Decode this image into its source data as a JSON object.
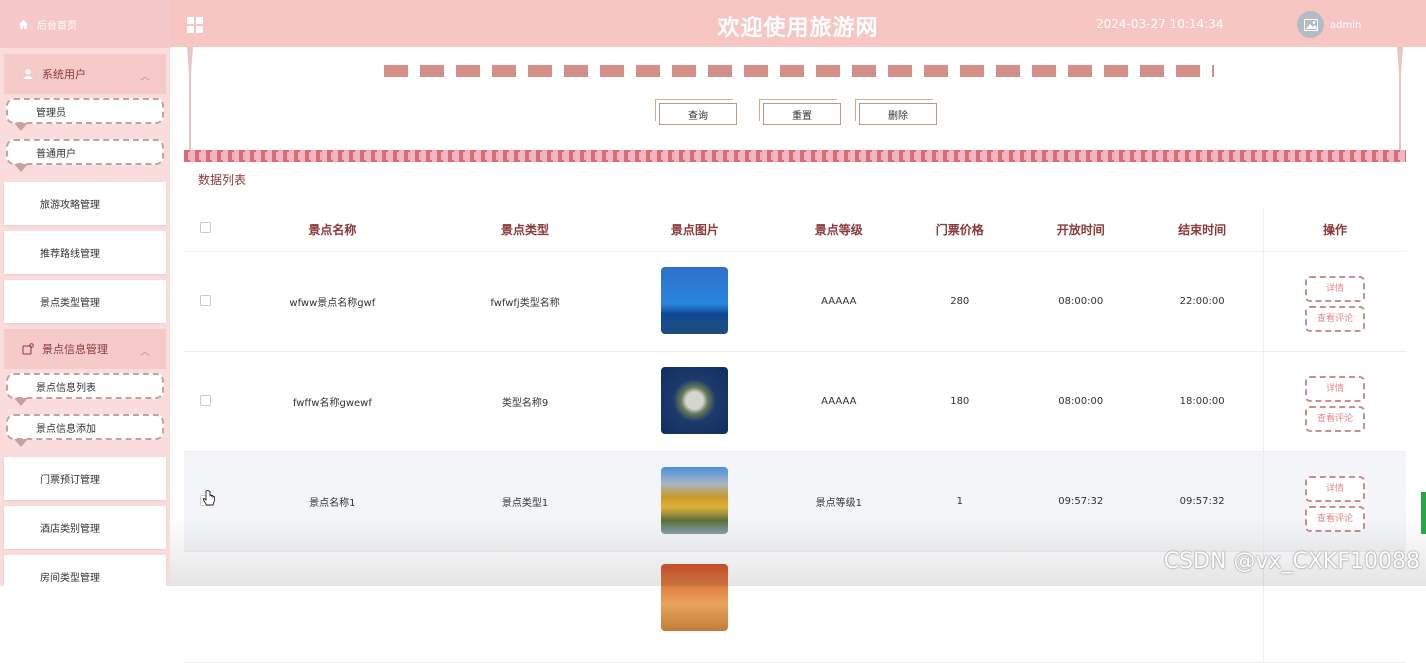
{
  "sidebar": {
    "home": "后台首页",
    "group1": {
      "label": "系统用户",
      "items": [
        "管理员",
        "普通用户"
      ]
    },
    "menu1": [
      "旅游攻略管理",
      "推荐路线管理",
      "景点类型管理"
    ],
    "group2": {
      "label": "景点信息管理",
      "items": [
        "景点信息列表",
        "景点信息添加"
      ]
    },
    "menu2": [
      "门票预订管理",
      "酒店类别管理",
      "房间类型管理"
    ]
  },
  "header": {
    "title": "欢迎使用旅游网",
    "datetime": "2024-03-27 10:14:34",
    "username": "admin"
  },
  "search": {
    "query": "查询",
    "reset": "重置",
    "delete": "删除"
  },
  "list_label": "数据列表",
  "table": {
    "headers": [
      "景点名称",
      "景点类型",
      "景点图片",
      "景点等级",
      "门票价格",
      "开放时间",
      "结束时间",
      "操作"
    ],
    "rows": [
      {
        "name": "wfww景点名称gwf",
        "type": "fwfwfj类型名称",
        "level": "AAAAA",
        "price": "280",
        "open": "08:00:00",
        "close": "22:00:00"
      },
      {
        "name": "fwffw名称gwewf",
        "type": "类型名称9",
        "level": "AAAAA",
        "price": "180",
        "open": "08:00:00",
        "close": "18:00:00"
      },
      {
        "name": "景点名称1",
        "type": "景点类型1",
        "level": "景点等级1",
        "price": "1",
        "open": "09:57:32",
        "close": "09:57:32"
      }
    ],
    "op_detail": "详情",
    "op_comments": "查看评论"
  },
  "watermark": "CSDN @vx_CXKF10088",
  "colors": {
    "header_bg": "#f7c6c2",
    "sidebar_bg": "#fbdcdc",
    "accent": "#8a3a3a"
  }
}
